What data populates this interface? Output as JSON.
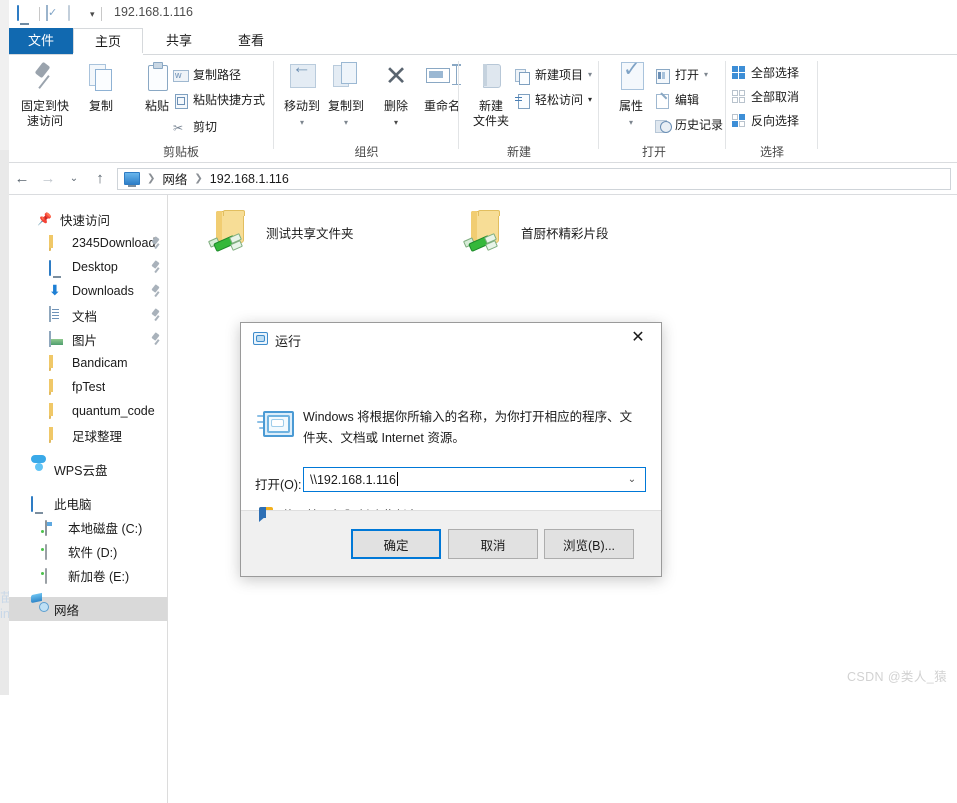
{
  "window": {
    "title_path": "192.168.1.116",
    "quick_access_icons": [
      "monitor-icon",
      "properties-icon",
      "new-folder-icon",
      "chevron-down-icon"
    ]
  },
  "tabs": [
    {
      "label": "文件",
      "state": "file-menu"
    },
    {
      "label": "主页",
      "state": "active"
    },
    {
      "label": "共享",
      "state": "normal"
    },
    {
      "label": "查看",
      "state": "normal"
    }
  ],
  "ribbon": {
    "groups": [
      {
        "name": "剪贴板",
        "big_buttons": [
          {
            "label": "固定到快\n速访问",
            "icon": "pin-icon"
          },
          {
            "label": "复制",
            "icon": "copy-icon"
          },
          {
            "label": "粘贴",
            "icon": "paste-icon"
          }
        ],
        "small_buttons": [
          {
            "label": "复制路径",
            "icon": "copy-path-icon"
          },
          {
            "label": "粘贴快捷方式",
            "icon": "paste-shortcut-icon"
          },
          {
            "label": "剪切",
            "icon": "scissors-icon"
          }
        ]
      },
      {
        "name": "组织",
        "big_buttons": [
          {
            "label": "移动到",
            "icon": "move-to-icon"
          },
          {
            "label": "复制到",
            "icon": "copy-to-icon"
          },
          {
            "label": "删除",
            "icon": "delete-x-icon"
          },
          {
            "label": "重命名",
            "icon": "rename-icon"
          }
        ],
        "small_buttons": []
      },
      {
        "name": "新建",
        "big_buttons": [
          {
            "label": "新建\n文件夹",
            "icon": "new-folder-icon"
          }
        ],
        "small_buttons": [
          {
            "label": "新建项目",
            "icon": "new-item-icon"
          },
          {
            "label": "轻松访问",
            "icon": "easy-access-icon"
          }
        ]
      },
      {
        "name": "打开",
        "big_buttons": [
          {
            "label": "属性",
            "icon": "properties-icon"
          }
        ],
        "small_buttons": [
          {
            "label": "打开",
            "icon": "open-icon"
          },
          {
            "label": "编辑",
            "icon": "edit-icon"
          },
          {
            "label": "历史记录",
            "icon": "history-icon"
          }
        ]
      },
      {
        "name": "选择",
        "big_buttons": [],
        "small_buttons": [
          {
            "label": "全部选择",
            "icon": "select-all-icon"
          },
          {
            "label": "全部取消",
            "icon": "select-none-icon"
          },
          {
            "label": "反向选择",
            "icon": "invert-selection-icon"
          }
        ]
      }
    ]
  },
  "address_bar": {
    "back": "←",
    "forward": "→",
    "recent": "⌄",
    "up": "↑",
    "crumbs": [
      "网络",
      "192.168.1.116"
    ]
  },
  "sidebar": {
    "items": [
      {
        "label": "快速访问",
        "icon": "star-pin-icon",
        "indent": 0,
        "pinned": false,
        "selected": false
      },
      {
        "label": "2345Download",
        "icon": "folder-icon",
        "indent": 1,
        "pinned": true,
        "selected": false
      },
      {
        "label": "Desktop",
        "icon": "desktop-icon",
        "indent": 1,
        "pinned": true,
        "selected": false
      },
      {
        "label": "Downloads",
        "icon": "downloads-icon",
        "indent": 1,
        "pinned": true,
        "selected": false
      },
      {
        "label": "文档",
        "icon": "documents-icon",
        "indent": 1,
        "pinned": true,
        "selected": false
      },
      {
        "label": "图片",
        "icon": "pictures-icon",
        "indent": 1,
        "pinned": true,
        "selected": false
      },
      {
        "label": "Bandicam",
        "icon": "folder-icon",
        "indent": 1,
        "pinned": false,
        "selected": false
      },
      {
        "label": "fpTest",
        "icon": "folder-icon",
        "indent": 1,
        "pinned": false,
        "selected": false
      },
      {
        "label": "quantum_code",
        "icon": "folder-icon",
        "indent": 1,
        "pinned": false,
        "selected": false
      },
      {
        "label": "足球整理",
        "icon": "folder-icon",
        "indent": 1,
        "pinned": false,
        "selected": false
      },
      {
        "label": "WPS云盘",
        "icon": "cloud-icon",
        "indent": 0,
        "pinned": false,
        "selected": false,
        "gap_before": true
      },
      {
        "label": "此电脑",
        "icon": "this-pc-icon",
        "indent": 0,
        "pinned": false,
        "selected": false,
        "gap_before": true
      },
      {
        "label": "本地磁盘 (C:)",
        "icon": "system-drive-icon",
        "indent": 1,
        "pinned": false,
        "selected": false
      },
      {
        "label": "软件 (D:)",
        "icon": "drive-icon",
        "indent": 1,
        "pinned": false,
        "selected": false
      },
      {
        "label": "新加卷 (E:)",
        "icon": "drive-icon",
        "indent": 1,
        "pinned": false,
        "selected": false
      },
      {
        "label": "网络",
        "icon": "network-icon",
        "indent": 0,
        "pinned": false,
        "selected": true,
        "gap_before": true
      }
    ]
  },
  "content": {
    "folders": [
      {
        "name": "测试共享文件夹",
        "icon": "shared-folder-icon"
      },
      {
        "name": "首厨杯精彩片段",
        "icon": "shared-folder-icon"
      }
    ]
  },
  "run_dialog": {
    "title": "运行",
    "title_icon": "run-icon",
    "close": "✕",
    "description": "Windows 将根据你所输入的名称，为你打开相应的程序、文件夹、文档或 Internet 资源。",
    "open_label": "打开(O):",
    "input_value": "\\\\192.168.1.116",
    "dropdown_arrow": "⌄",
    "admin_note": "使用管理权限创建此任务。",
    "buttons": [
      {
        "label": "确定",
        "primary": true
      },
      {
        "label": "取消",
        "primary": false
      },
      {
        "label": "浏览(B)...",
        "primary": false
      }
    ]
  },
  "watermark": "CSDN @类人_猿",
  "colors": {
    "accent": "#0078d7",
    "tab_file": "#1169b0",
    "selection": "#d9d9d9",
    "folder_yellow": "#f7dd96",
    "share_green": "#35b83b"
  }
}
